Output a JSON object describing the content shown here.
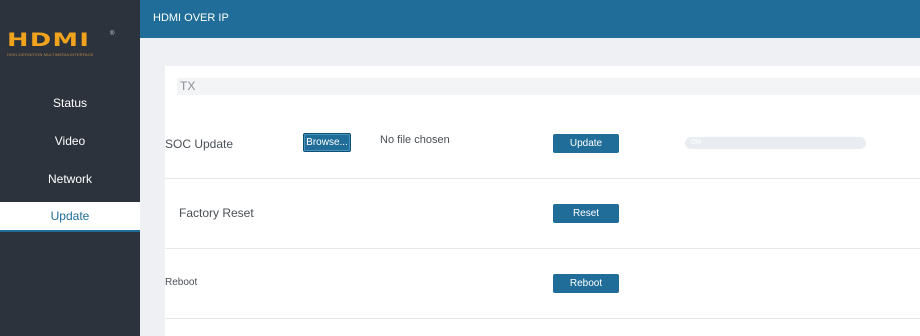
{
  "logo": {
    "mark": "HDMI",
    "reg": "®",
    "tagline": "HIGH-DEFINITION MULTIMEDIA INTERFACE"
  },
  "sidebar": {
    "items": [
      {
        "label": "Status",
        "active": false
      },
      {
        "label": "Video",
        "active": false
      },
      {
        "label": "Network",
        "active": false
      },
      {
        "label": "Update",
        "active": true
      }
    ]
  },
  "header": {
    "title": "HDMI OVER IP"
  },
  "panel": {
    "section_title": "TX",
    "soc_update": {
      "label": "SOC Update",
      "browse_label": "Browse...",
      "file_status": "No file chosen",
      "update_label": "Update",
      "progress_value": 0,
      "progress_text": "0%"
    },
    "factory_reset": {
      "label": "Factory Reset",
      "button_label": "Reset"
    },
    "reboot": {
      "label": "Reboot",
      "button_label": "Reboot"
    }
  },
  "colors": {
    "accent": "#1f6d98",
    "sidebar_bg": "#2c333c",
    "logo_orange": "#f0a31c"
  }
}
